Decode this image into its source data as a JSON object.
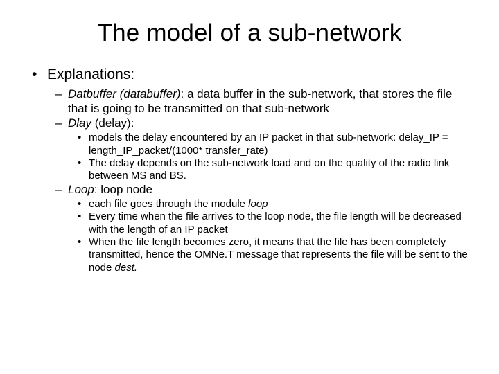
{
  "title": "The model of a sub-network",
  "l1": {
    "t0": "Explanations:"
  },
  "l2": {
    "datbuffer_label": "Datbuffer (databuffer)",
    "datbuffer_rest": ": a data buffer in the sub-network, that stores the file that is going to be transmitted on that sub-network",
    "dlay_label": "Dlay",
    "dlay_rest": " (delay):",
    "loop_label": "Loop",
    "loop_rest": ": loop node"
  },
  "l3": {
    "dlay0": "models the delay encountered by an IP packet in that sub-network: delay_IP = length_IP_packet/(1000* transfer_rate)",
    "dlay1": "The delay depends on the sub-network load  and on the quality of the radio link between MS and BS.",
    "loop0_a": "each file goes through the module ",
    "loop0_b": "loop",
    "loop1": "Every time when the file arrives to the loop node, the file length will be decreased with the length of an IP packet",
    "loop2_a": "When the file length becomes zero, it means that the file has been completely transmitted, hence the OMNe.T message that represents the file will be sent to the node ",
    "loop2_b": "dest."
  }
}
